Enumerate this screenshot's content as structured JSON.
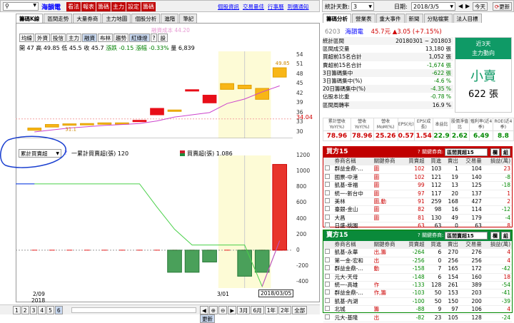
{
  "toolbar": {
    "search_value": "",
    "stock_name": "海韻電",
    "red_buttons": [
      "看法",
      "報表",
      "籌碼",
      "主力",
      "設定",
      "籌碼"
    ],
    "links": [
      "個股資訊",
      "交易量佳",
      "行事曆",
      "到價通知"
    ]
  },
  "chart_tabs": [
    "籌碼K線",
    "區間走勢",
    "大量券商",
    "主力地圖",
    "個股分析",
    "進階",
    "筆記"
  ],
  "sub_buttons": [
    "均線",
    "外資",
    "投信",
    "主力",
    "融資",
    "布林",
    "趨勢",
    "紅綠燈",
    "?",
    "設"
  ],
  "active_sub": "紅綠燈",
  "cost_label": "融資成本 44.20",
  "ohlc": {
    "open": "開 47",
    "high": "高 49.85",
    "low": "低 45.5",
    "close": "收 45.7",
    "change_label": "漲跌",
    "change": "-0.15",
    "pct_label": "漲幅",
    "pct": "-0.33%",
    "vol": "量 6,839"
  },
  "price_axis": [
    "54",
    "51",
    "48",
    "45",
    "42",
    "39",
    "36",
    "33",
    "30"
  ],
  "price_marker": "34.04",
  "box_labels": [
    "31.1",
    "49.85"
  ],
  "lower_axis": [
    "1200",
    "1000",
    "800",
    "600",
    "400",
    "200",
    "0",
    "-200",
    "-400"
  ],
  "lower_select": "累計買賣超",
  "legend1": "一累計買賣超(張) 120",
  "legend2": "買賣超(張) 1,086",
  "x_labels": [
    "2/09",
    "2018",
    "3/01",
    "2018/03/05"
  ],
  "bottom_pages": [
    "1",
    "2",
    "3",
    "4",
    "5",
    "6"
  ],
  "bottom_zoom": [
    "3月",
    "6月",
    "1年",
    "2年",
    "全部",
    "更新"
  ],
  "right_top": {
    "days_label": "統計天數:",
    "days": "3",
    "date_label": "日期:",
    "date": "2018/3/5",
    "today": "今天",
    "refresh": "更新"
  },
  "right_tabs": [
    "籌碼分析",
    "營業表",
    "重大事件",
    "新聞",
    "分點檔案",
    "法人目標"
  ],
  "quote": {
    "code": "6203",
    "name": "海韻電",
    "price": "45.7元",
    "change": "▲3.05",
    "pct": "(+7.15%)"
  },
  "stats": [
    [
      "統計區間",
      "20180301 ~ 201803"
    ],
    [
      "區間成交量",
      "13,180 張"
    ],
    [
      "買超前15名合計",
      "1,052 張"
    ],
    [
      "賣超前15名合計",
      "-1,674 張"
    ],
    [
      "3日籌碼集中",
      "-622 張"
    ],
    [
      "3日籌碼集中(%)",
      "-4.6 %"
    ],
    [
      "20日籌碼集中(%)",
      "-4.35 %"
    ],
    [
      "佔股本比重",
      "-0.78 %"
    ],
    [
      "區間周轉率",
      "16.9 %"
    ]
  ],
  "recent_box": {
    "title": "近3天",
    "sub": "主力動向",
    "big": "小賣",
    "vol": "622 張"
  },
  "metric_headers": [
    "累計營收YoY(%)",
    "營收YoY(%)",
    "營收MoM(%)",
    "EPS(元)",
    "EPS(成長)",
    "本益比",
    "股價淨值比",
    "殖利率(近4季)",
    "ROE(近4季)"
  ],
  "metric_values": [
    "78.96",
    "78.96",
    "25.26",
    "0.57",
    "1.54",
    "22.9",
    "2.62",
    "6.49",
    "8.8"
  ],
  "buy_panel": {
    "title": "買方15",
    "filter": "? 關鍵券商:",
    "select": "區間買超15",
    "b1": "欄",
    "b2": "組",
    "headers": [
      "券商名稱",
      "關鍵券商",
      "買賣超",
      "買進",
      "賣出",
      "交易量",
      "損益(萬)"
    ],
    "rows": [
      [
        "群益金鼎-...",
        "圖",
        "102",
        "103",
        "1",
        "104",
        "23"
      ],
      [
        "國票-中港",
        "圖",
        "102",
        "121",
        "19",
        "140",
        "-8"
      ],
      [
        "凱基-幸福",
        "圖",
        "99",
        "112",
        "13",
        "125",
        "-18"
      ],
      [
        "統一-新台中",
        "圖",
        "97",
        "117",
        "20",
        "137",
        "1"
      ],
      [
        "美林",
        "圖,動",
        "91",
        "259",
        "168",
        "427",
        "2"
      ],
      [
        "臺銀-金山",
        "圖",
        "82",
        "98",
        "16",
        "114",
        "-12"
      ],
      [
        "大昌",
        "圖",
        "81",
        "130",
        "49",
        "179",
        "-4"
      ],
      [
        "日盛-桃園",
        "",
        "63",
        "63",
        "0",
        "63",
        "8"
      ],
      [
        "凱基-東港",
        "",
        "56",
        "58",
        "2",
        "60",
        "-6"
      ]
    ]
  },
  "sell_panel": {
    "title": "賣方15",
    "filter": "? 關鍵券商:",
    "select": "區間賣超15",
    "b1": "欄",
    "b2": "組",
    "headers": [
      "券商名稱",
      "關鍵券商",
      "買賣超",
      "買進",
      "賣出",
      "交易量",
      "損益(萬)"
    ],
    "rows": [
      [
        "凱基-永華",
        "出,籌",
        "-264",
        "6",
        "270",
        "276",
        "4"
      ],
      [
        "第一金-宏和",
        "出",
        "-256",
        "0",
        "256",
        "256",
        "4"
      ],
      [
        "群益金鼎-...",
        "動",
        "-158",
        "7",
        "165",
        "172",
        "-42"
      ],
      [
        "元大-天母",
        "",
        "-148",
        "6",
        "154",
        "160",
        "18"
      ],
      [
        "統一-高雄",
        "作",
        "-133",
        "128",
        "261",
        "389",
        "-54"
      ],
      [
        "群益金鼎-...",
        "作,籌",
        "-103",
        "50",
        "153",
        "203",
        "-41"
      ],
      [
        "凱基-內湖",
        "",
        "-100",
        "50",
        "150",
        "200",
        "-39"
      ],
      [
        "北城",
        "籌",
        "-88",
        "9",
        "97",
        "106",
        "4"
      ],
      [
        "元大-基隆",
        "出",
        "-82",
        "23",
        "105",
        "128",
        "-24"
      ]
    ]
  },
  "colors": {
    "accent_red": "#d00000",
    "buy_bar": "#cc1e2e",
    "sell_bar": "#1e8c3c",
    "panel_head": "#e8e8e8"
  },
  "chart_data": [
    {
      "type": "candlestick",
      "ylim": [
        28,
        55
      ],
      "categories": [
        "c1",
        "c2",
        "c3",
        "c4",
        "c5",
        "c6",
        "c7",
        "c8",
        "c9",
        "c10",
        "c11",
        "c12",
        "c13",
        "c14",
        "c15"
      ],
      "values": [
        {
          "o": 30.5,
          "c": 31.2,
          "up": false
        },
        {
          "o": 31.5,
          "c": 32.3,
          "up": false
        },
        {
          "o": 32.5,
          "c": 32.2,
          "up": false
        },
        {
          "o": 32.3,
          "c": 32.6,
          "up": false
        },
        {
          "o": 32.8,
          "c": 32.5,
          "up": false
        },
        {
          "o": 32.8,
          "c": 32.8,
          "up": false
        },
        {
          "o": 33.5,
          "c": 33.6,
          "up": true
        },
        {
          "o": 35.3,
          "c": 37.3,
          "up": true
        },
        {
          "o": 36.5,
          "c": 36.8,
          "up": false
        },
        {
          "o": 43.0,
          "c": 43.1,
          "up": true
        },
        {
          "o": 39.0,
          "c": 41.4,
          "up": true
        },
        {
          "o": 43.2,
          "c": 45.0,
          "up": false
        },
        {
          "o": 43.4,
          "c": 44.5,
          "up": false
        },
        {
          "o": 40.1,
          "c": 43.5,
          "up": false
        },
        {
          "o": 47.0,
          "c": 49.9,
          "up": false
        }
      ],
      "ma": [
        30,
        30.6,
        31.2,
        31.6,
        32,
        32.3,
        32.6,
        33.4,
        34.6,
        35.3,
        36,
        38.8,
        40.2,
        42.4,
        44.3
      ]
    },
    {
      "type": "bar+line",
      "ylim": [
        -480,
        1200
      ],
      "bars": [
        0,
        0,
        0,
        0,
        0,
        0,
        0,
        0,
        -280,
        -280,
        -150,
        0,
        -330,
        -280,
        1086
      ],
      "line": [
        0,
        0,
        0,
        0,
        0,
        0,
        0,
        0,
        0,
        0,
        0,
        0,
        0,
        0,
        0
      ],
      "cum": [
        840,
        840,
        840,
        840,
        840,
        840,
        840,
        545,
        265,
        65,
        65,
        65,
        65,
        -460,
        120
      ]
    }
  ]
}
